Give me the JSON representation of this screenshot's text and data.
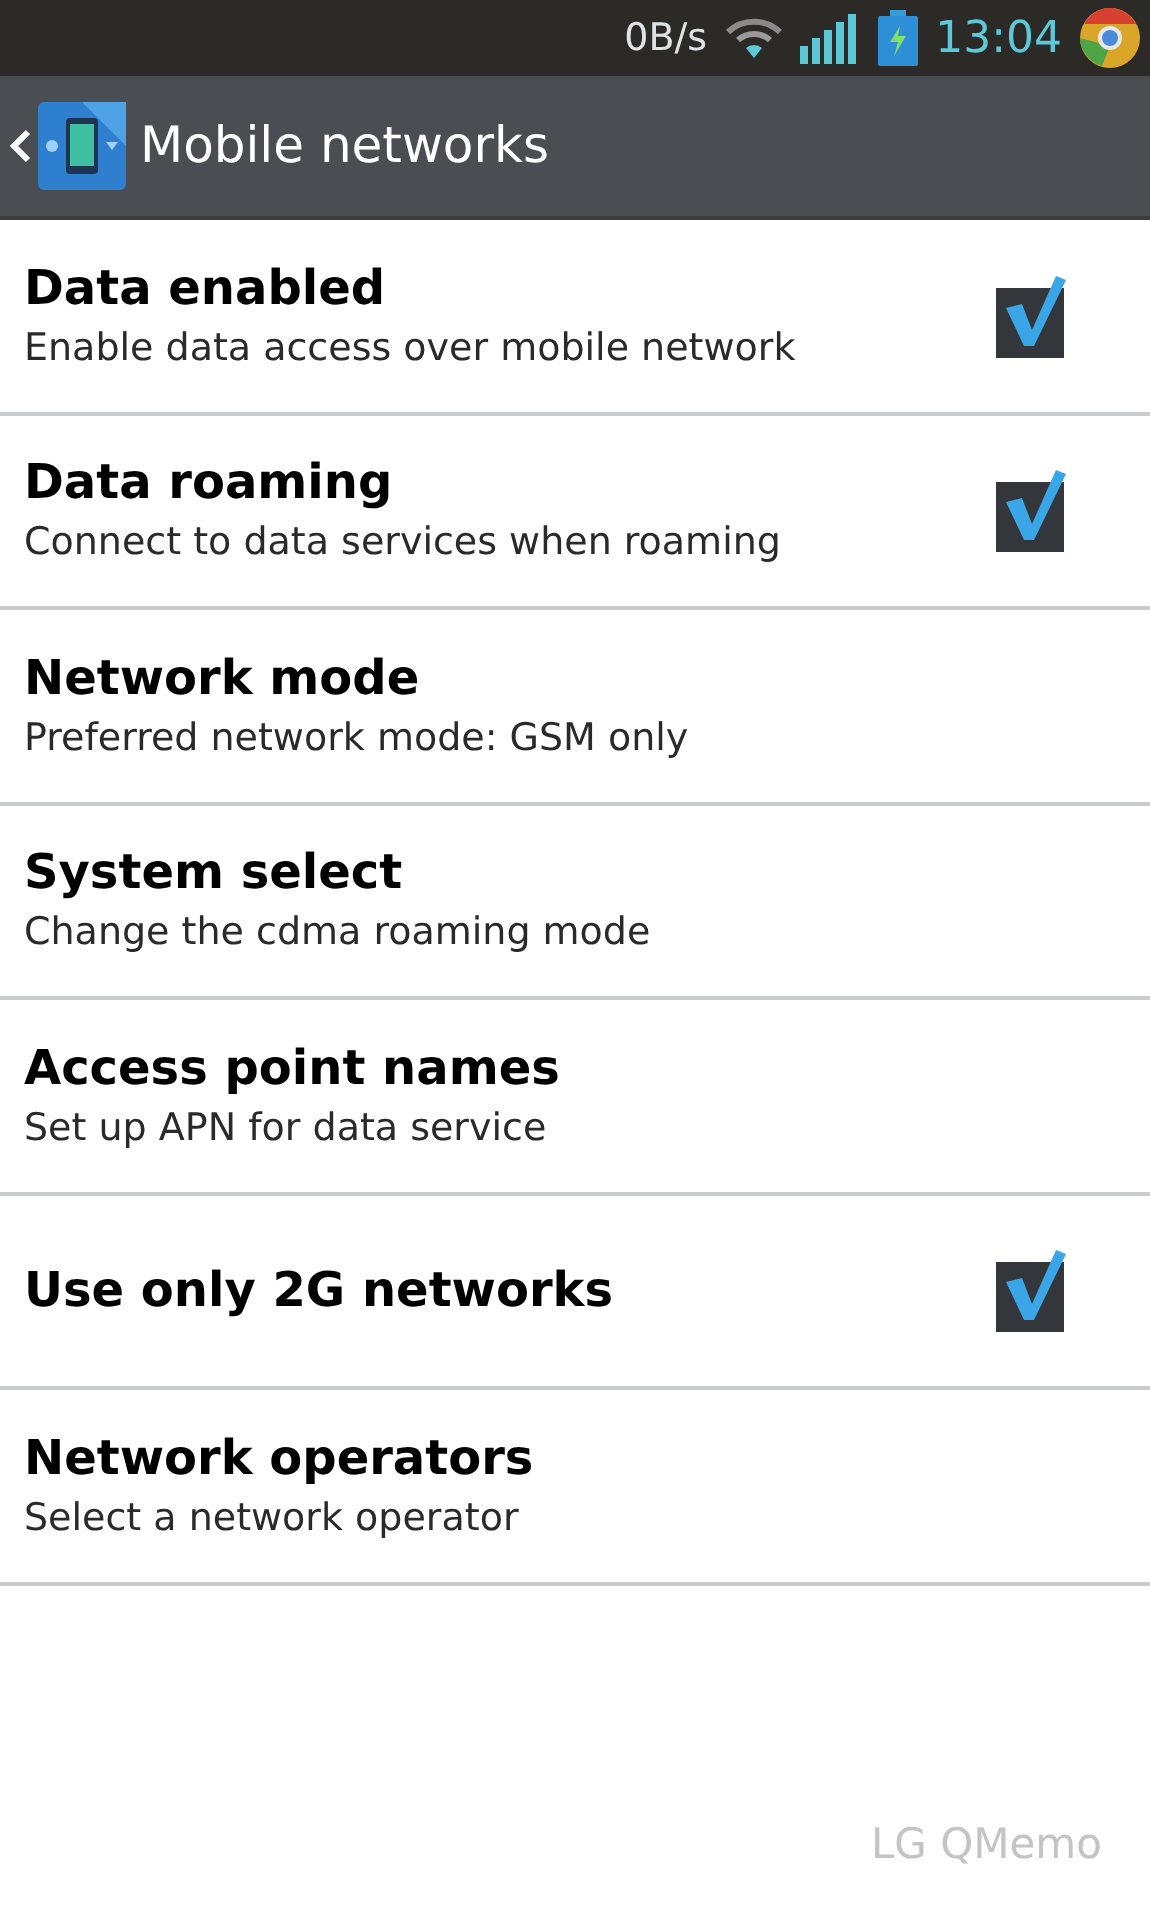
{
  "status_bar": {
    "data_rate": "0B/s",
    "time": "13:04"
  },
  "action_bar": {
    "title": "Mobile networks"
  },
  "settings": [
    {
      "kind": "checkbox",
      "title": "Data enabled",
      "summary": "Enable data access over mobile network",
      "checked": true
    },
    {
      "kind": "checkbox",
      "title": "Data roaming",
      "summary": "Connect to data services when roaming",
      "checked": true
    },
    {
      "kind": "plain",
      "title": "Network mode",
      "summary": "Preferred network mode: GSM only"
    },
    {
      "kind": "plain",
      "title": "System select",
      "summary": "Change the cdma roaming mode"
    },
    {
      "kind": "plain",
      "title": "Access point names",
      "summary": "Set up APN for data service"
    },
    {
      "kind": "checkbox",
      "title": "Use only 2G networks",
      "checked": true
    },
    {
      "kind": "plain",
      "title": "Network operators",
      "summary": "Select a network operator"
    }
  ],
  "footer_label": "LG QMemo"
}
